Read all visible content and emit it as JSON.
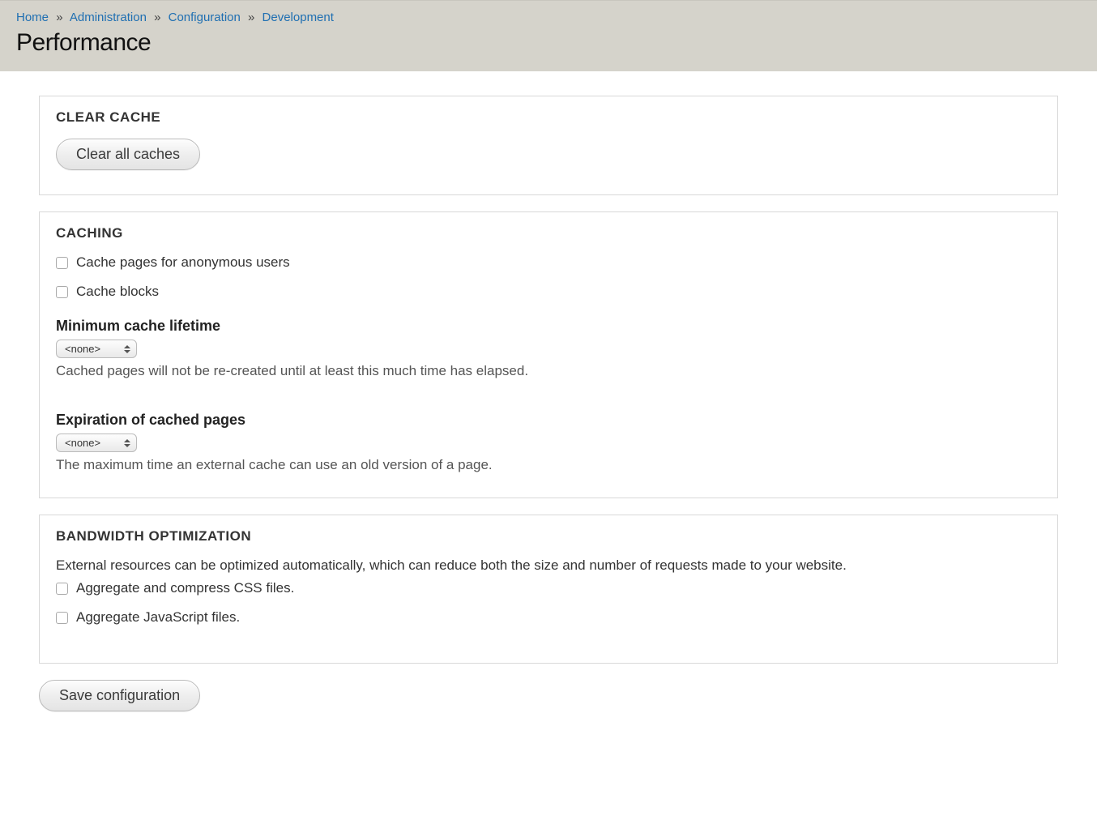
{
  "breadcrumb": {
    "items": [
      {
        "label": "Home"
      },
      {
        "label": "Administration"
      },
      {
        "label": "Configuration"
      },
      {
        "label": "Development"
      }
    ],
    "separator": "»"
  },
  "page": {
    "title": "Performance"
  },
  "sections": {
    "clear_cache": {
      "heading": "CLEAR CACHE",
      "button_label": "Clear all caches"
    },
    "caching": {
      "heading": "CACHING",
      "cache_pages_label": "Cache pages for anonymous users",
      "cache_blocks_label": "Cache blocks",
      "min_lifetime_label": "Minimum cache lifetime",
      "min_lifetime_value": "<none>",
      "min_lifetime_desc": "Cached pages will not be re-created until at least this much time has elapsed.",
      "expiration_label": "Expiration of cached pages",
      "expiration_value": "<none>",
      "expiration_desc": "The maximum time an external cache can use an old version of a page."
    },
    "bandwidth": {
      "heading": "BANDWIDTH OPTIMIZATION",
      "intro": "External resources can be optimized automatically, which can reduce both the size and number of requests made to your website.",
      "aggregate_css_label": "Aggregate and compress CSS files.",
      "aggregate_js_label": "Aggregate JavaScript files."
    }
  },
  "actions": {
    "save_label": "Save configuration"
  }
}
